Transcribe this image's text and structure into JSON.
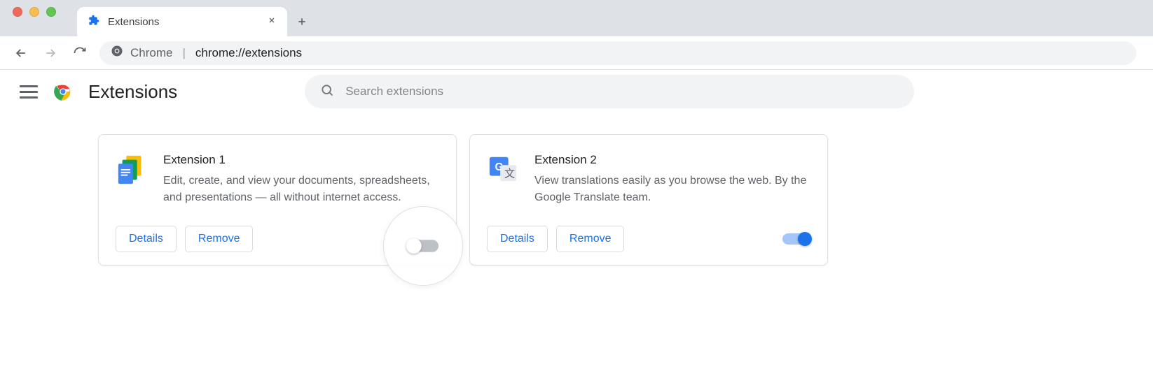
{
  "window": {
    "tab_title": "Extensions"
  },
  "browser": {
    "url_scheme_label": "Chrome",
    "url": "chrome://extensions",
    "url_display_prefix": "chrome://",
    "url_display_path": "extensions"
  },
  "header": {
    "title": "Extensions"
  },
  "search": {
    "placeholder": "Search extensions",
    "value": ""
  },
  "buttons": {
    "details": "Details",
    "remove": "Remove"
  },
  "extensions": [
    {
      "id": "ext1",
      "name": "Extension 1",
      "description": "Edit, create, and view your documents, spreadsheets, and presentations — all without internet access.",
      "enabled": false,
      "icon": "docs-suite-icon",
      "highlighted_toggle": true
    },
    {
      "id": "ext2",
      "name": "Extension 2",
      "description": "View translations easily as you browse the web. By the Google Translate team.",
      "enabled": true,
      "icon": "translate-icon",
      "highlighted_toggle": false
    }
  ],
  "colors": {
    "accent": "#1a73e8",
    "text_primary": "#202124",
    "text_secondary": "#5f6368",
    "surface": "#f1f3f4",
    "border": "#e0e0e0"
  }
}
